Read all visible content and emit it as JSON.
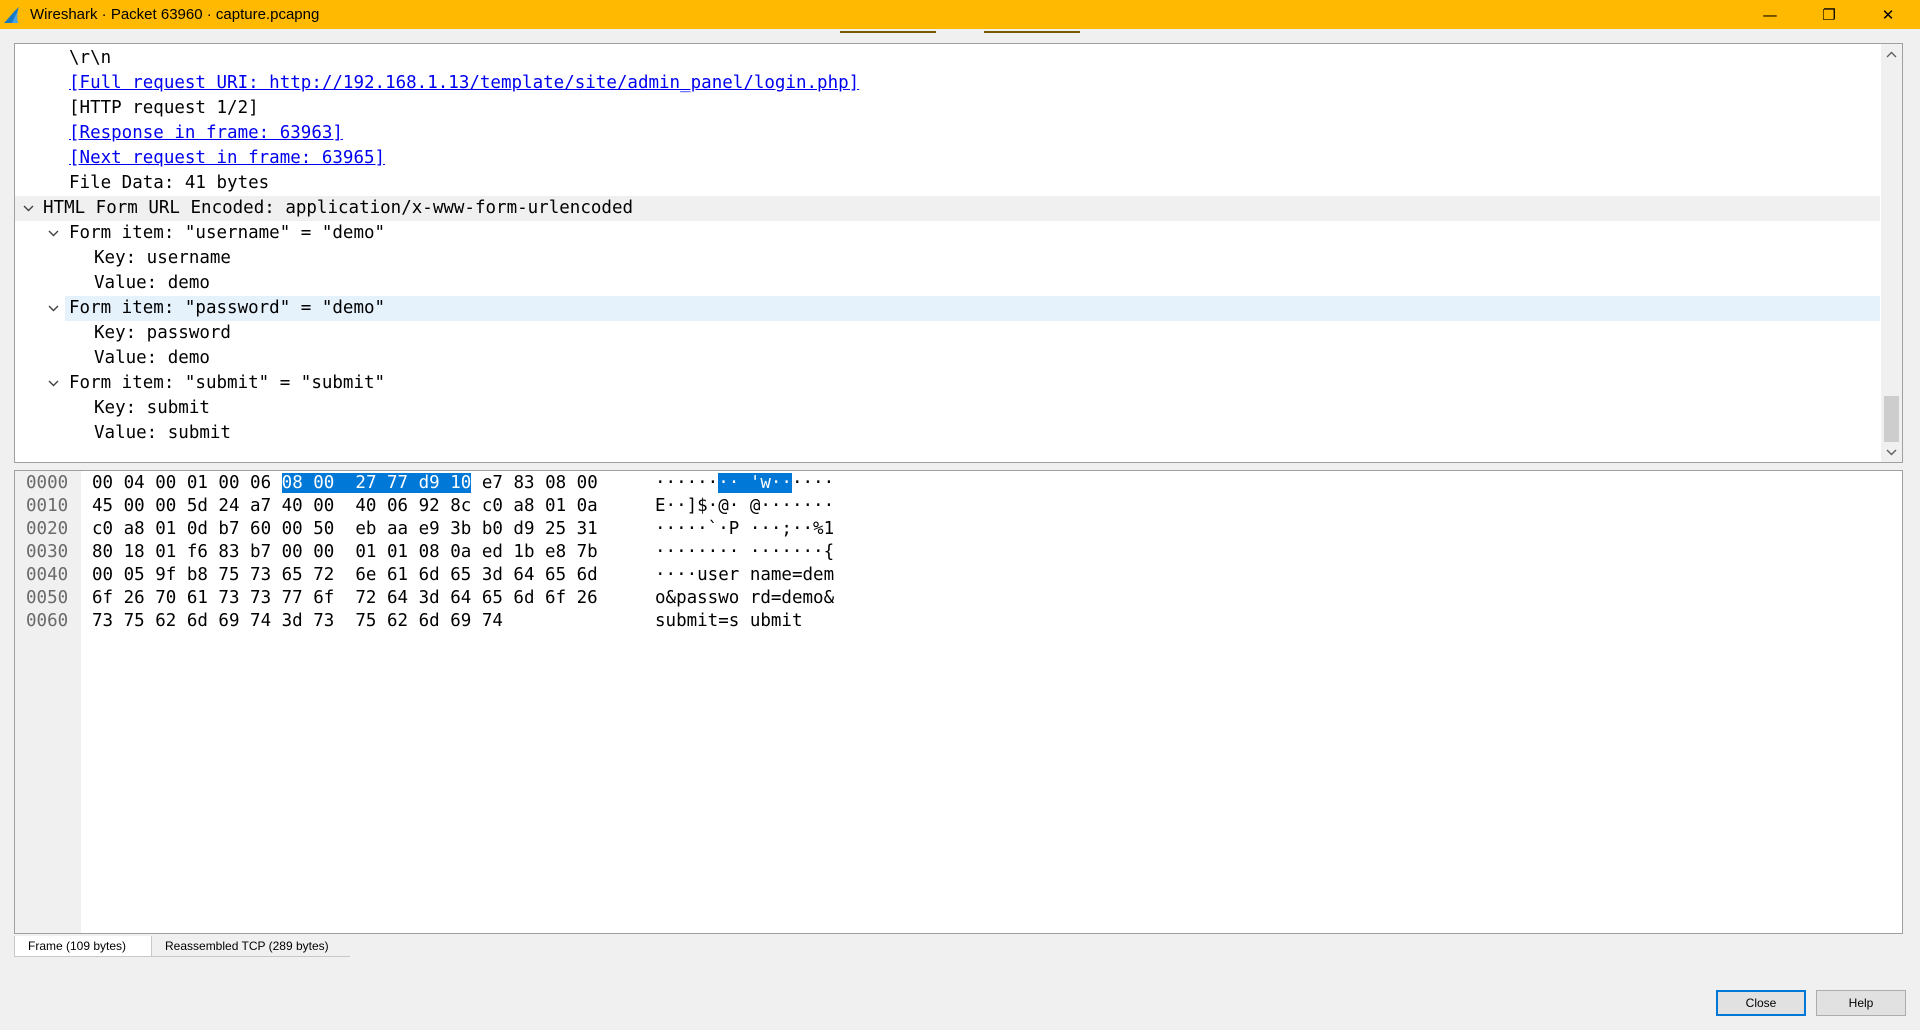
{
  "window": {
    "title": "Wireshark · Packet 63960 · capture.pcapng",
    "controls": {
      "minimize": "—",
      "maximize": "❐",
      "close": "✕"
    },
    "accent_color": "#ffb900"
  },
  "detail_tree": [
    {
      "text": "\\r\\n",
      "indent": 2,
      "link": false
    },
    {
      "text": "[Full request URI: http://192.168.1.13/template/site/admin_panel/login.php]",
      "indent": 2,
      "link": true
    },
    {
      "text": "[HTTP request 1/2]",
      "indent": 2,
      "link": false
    },
    {
      "text": "[Response in frame: 63963]",
      "indent": 2,
      "link": true
    },
    {
      "text": "[Next request in frame: 63965]",
      "indent": 2,
      "link": true
    },
    {
      "text": "File Data: 41 bytes",
      "indent": 2,
      "link": false
    },
    {
      "text": "HTML Form URL Encoded: application/x-www-form-urlencoded",
      "indent": 1,
      "expanded": true,
      "link": false
    },
    {
      "text": "Form item: \"username\" = \"demo\"",
      "indent": 2,
      "expanded": true,
      "link": false
    },
    {
      "text": "Key: username",
      "indent": 3,
      "link": false
    },
    {
      "text": "Value: demo",
      "indent": 3,
      "link": false
    },
    {
      "text": "Form item: \"password\" = \"demo\"",
      "indent": 2,
      "expanded": true,
      "link": false
    },
    {
      "text": "Key: password",
      "indent": 3,
      "link": false
    },
    {
      "text": "Value: demo",
      "indent": 3,
      "link": false
    },
    {
      "text": "Form item: \"submit\" = \"submit\"",
      "indent": 2,
      "expanded": true,
      "link": false
    },
    {
      "text": "Key: submit",
      "indent": 3,
      "link": false
    },
    {
      "text": "Value: submit",
      "indent": 3,
      "link": false
    }
  ],
  "hex_dump": [
    {
      "offset": "0000",
      "bytes_pre": "00 04 00 01 00 06 ",
      "bytes_hl": "08 00  27 77 d9 10",
      "bytes_post": " e7 83 08 00",
      "ascii_pre": "······",
      "ascii_hl": "·· 'w··",
      "ascii_post": "····"
    },
    {
      "offset": "0010",
      "bytes": "45 00 00 5d 24 a7 40 00  40 06 92 8c c0 a8 01 0a",
      "ascii": "E··]$·@· @·······"
    },
    {
      "offset": "0020",
      "bytes": "c0 a8 01 0d b7 60 00 50  eb aa e9 3b b0 d9 25 31",
      "ascii": "·····`·P ···;··%1"
    },
    {
      "offset": "0030",
      "bytes": "80 18 01 f6 83 b7 00 00  01 01 08 0a ed 1b e8 7b",
      "ascii": "········ ·······{"
    },
    {
      "offset": "0040",
      "bytes": "00 05 9f b8 75 73 65 72  6e 61 6d 65 3d 64 65 6d",
      "ascii": "····user name=dem"
    },
    {
      "offset": "0050",
      "bytes": "6f 26 70 61 73 73 77 6f  72 64 3d 64 65 6d 6f 26",
      "ascii": "o&passwo rd=demo&"
    },
    {
      "offset": "0060",
      "bytes": "73 75 62 6d 69 74 3d 73  75 62 6d 69 74",
      "ascii": "submit=s ubmit"
    }
  ],
  "tabs": [
    {
      "label": "Frame (109 bytes)",
      "active": true
    },
    {
      "label": "Reassembled TCP (289 bytes)",
      "active": false
    }
  ],
  "buttons": {
    "close": "Close",
    "help": "Help"
  },
  "colors": {
    "selection": "#0078d7",
    "link": "#0000ee",
    "row_hover": "#e5f1fb"
  }
}
